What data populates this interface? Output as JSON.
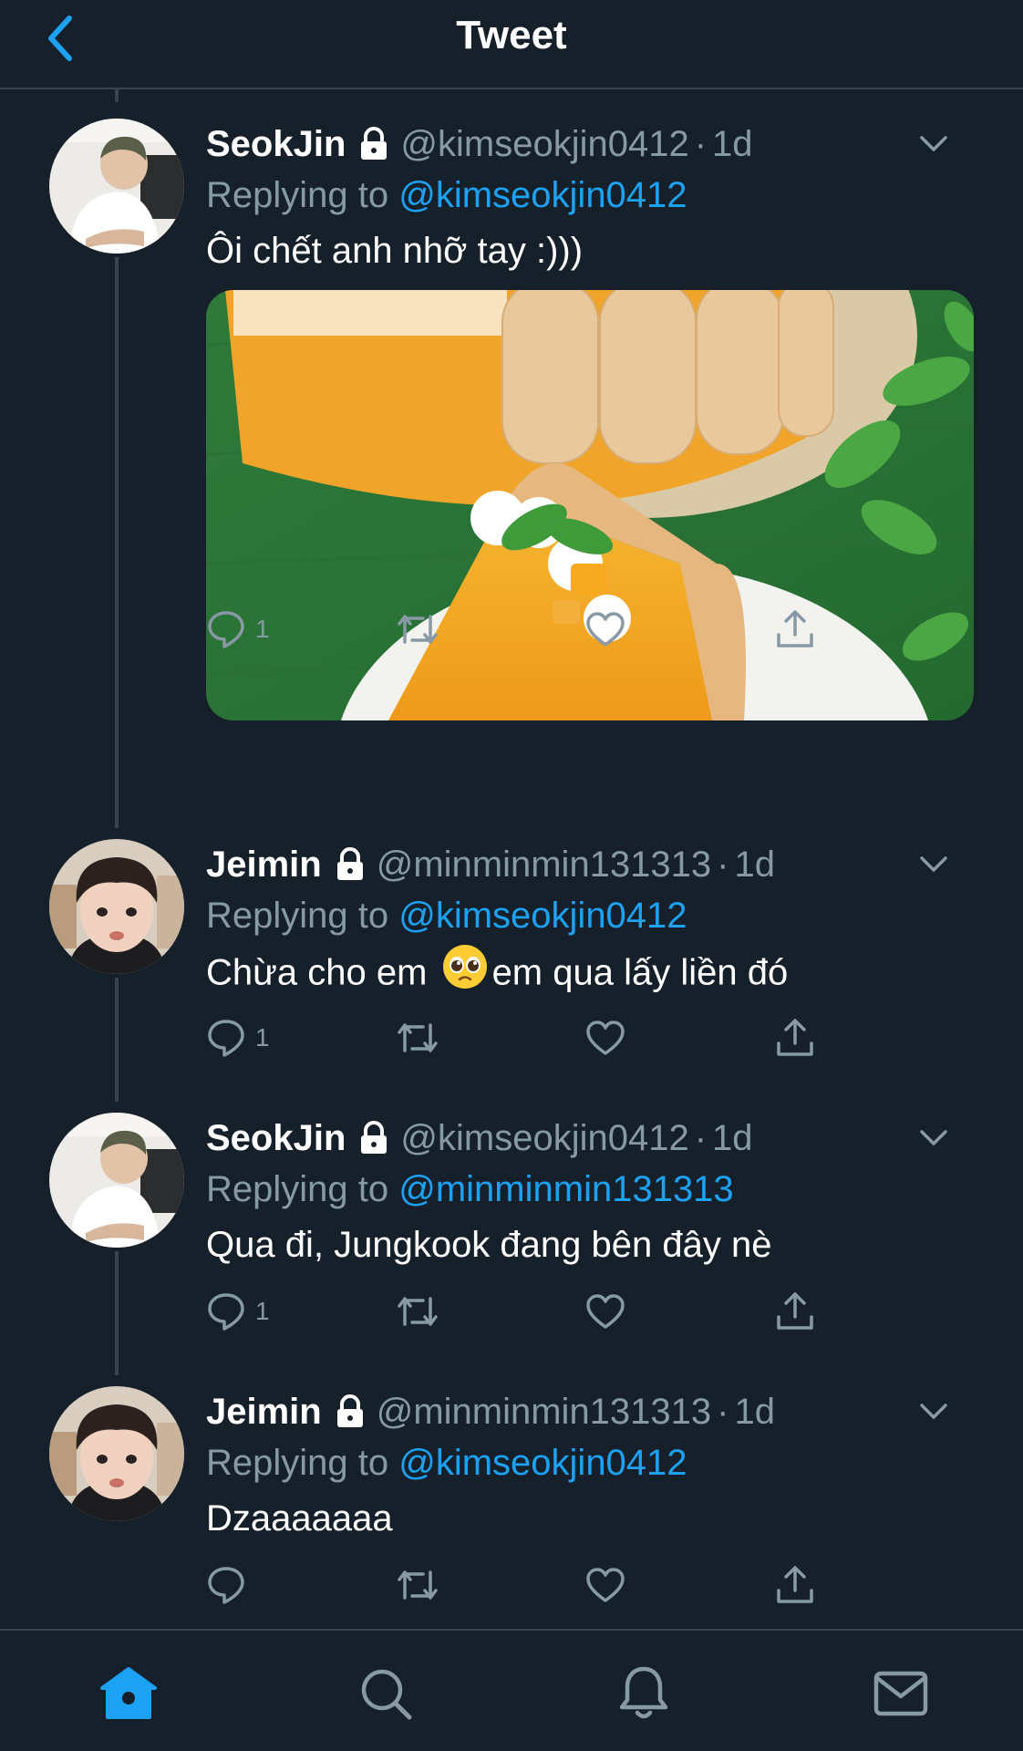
{
  "header": {
    "title": "Tweet",
    "back_icon": "chevron-left-icon",
    "accent": "#1da1f2"
  },
  "colors": {
    "background": "#15202b",
    "divider": "#38444d",
    "secondary_text": "#8899a6",
    "link": "#1da1f2"
  },
  "replying_prefix": "Replying to ",
  "tweets": [
    {
      "display_name": "SeokJin",
      "handle": "@kimseokjin0412",
      "dot": "·",
      "time": "1d",
      "replying_to": "@kimseokjin0412",
      "text": "Ôi chết anh nhỡ tay :)))",
      "media": "mango charlotte cake slice on white plate, green table with mint leaves",
      "reply_count": "1"
    },
    {
      "display_name": "Jeimin",
      "handle": "@minminmin131313",
      "dot": "·",
      "time": "1d",
      "replying_to": "@kimseokjin0412",
      "text_before_emoji": "Chừa cho em ",
      "emoji": "pleading-face-emoji",
      "text_after_emoji": "em qua lấy liền đó",
      "reply_count": "1"
    },
    {
      "display_name": "SeokJin",
      "handle": "@kimseokjin0412",
      "dot": "·",
      "time": "1d",
      "replying_to": "@minminmin131313",
      "text": "Qua đi, Jungkook đang bên đây nè",
      "reply_count": "1"
    },
    {
      "display_name": "Jeimin",
      "handle": "@minminmin131313",
      "dot": "·",
      "time": "1d",
      "replying_to": "@kimseokjin0412",
      "text": "Dzaaaaaaa",
      "reply_count": ""
    }
  ],
  "bottom_nav": {
    "items": [
      "home-icon",
      "search-icon",
      "bell-icon",
      "mail-icon"
    ],
    "active": "home-icon"
  }
}
